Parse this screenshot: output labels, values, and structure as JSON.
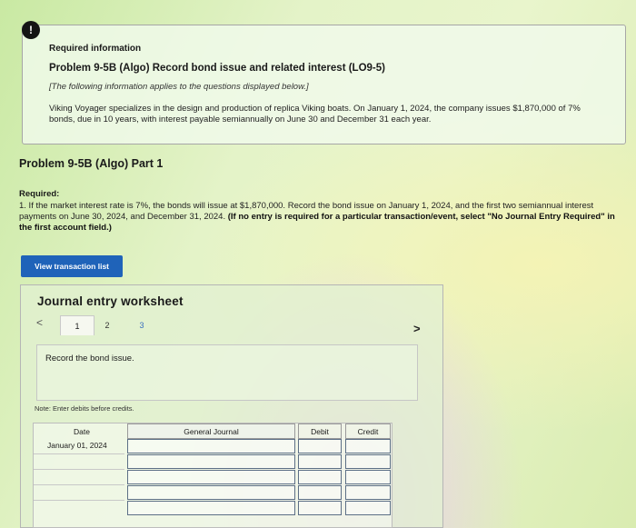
{
  "info": {
    "icon_text": "!",
    "heading": "Required information",
    "title": "Problem 9-5B (Algo) Record bond issue and related interest (LO9-5)",
    "italic_note": "[The following information applies to the questions displayed below.]",
    "body": "Viking Voyager specializes in the design and production of replica Viking boats. On January 1, 2024, the company issues $1,870,000 of 7% bonds, due in 10 years, with interest payable semiannually on June 30 and December 31 each year."
  },
  "part": {
    "title": "Problem 9-5B (Algo) Part 1",
    "required_label": "Required:",
    "required_text": "1. If the market interest rate is 7%, the bonds will issue at $1,870,000. Record the bond issue on January 1, 2024, and the first two semiannual interest payments on June 30, 2024, and December 31, 2024.",
    "required_bold": "(If no entry is required for a particular transaction/event, select \"No Journal Entry Required\" in the first account field.)"
  },
  "view_transaction_button": "View transaction list",
  "worksheet": {
    "title": "Journal entry worksheet",
    "prev_arrow": "<",
    "next_arrow": ">",
    "tabs": [
      "1",
      "2",
      "3"
    ],
    "active_tab": "1",
    "task": "Record the bond issue.",
    "note": "Note: Enter debits before credits.",
    "table": {
      "headers": {
        "date": "Date",
        "general_journal": "General Journal",
        "debit": "Debit",
        "credit": "Credit"
      },
      "date_value": "January 01, 2024",
      "rows": [
        {
          "account": "",
          "debit": "",
          "credit": ""
        },
        {
          "account": "",
          "debit": "",
          "credit": ""
        },
        {
          "account": "",
          "debit": "",
          "credit": ""
        },
        {
          "account": "",
          "debit": "",
          "credit": ""
        },
        {
          "account": "",
          "debit": "",
          "credit": ""
        },
        {
          "account": "",
          "debit": "",
          "credit": ""
        }
      ]
    }
  }
}
